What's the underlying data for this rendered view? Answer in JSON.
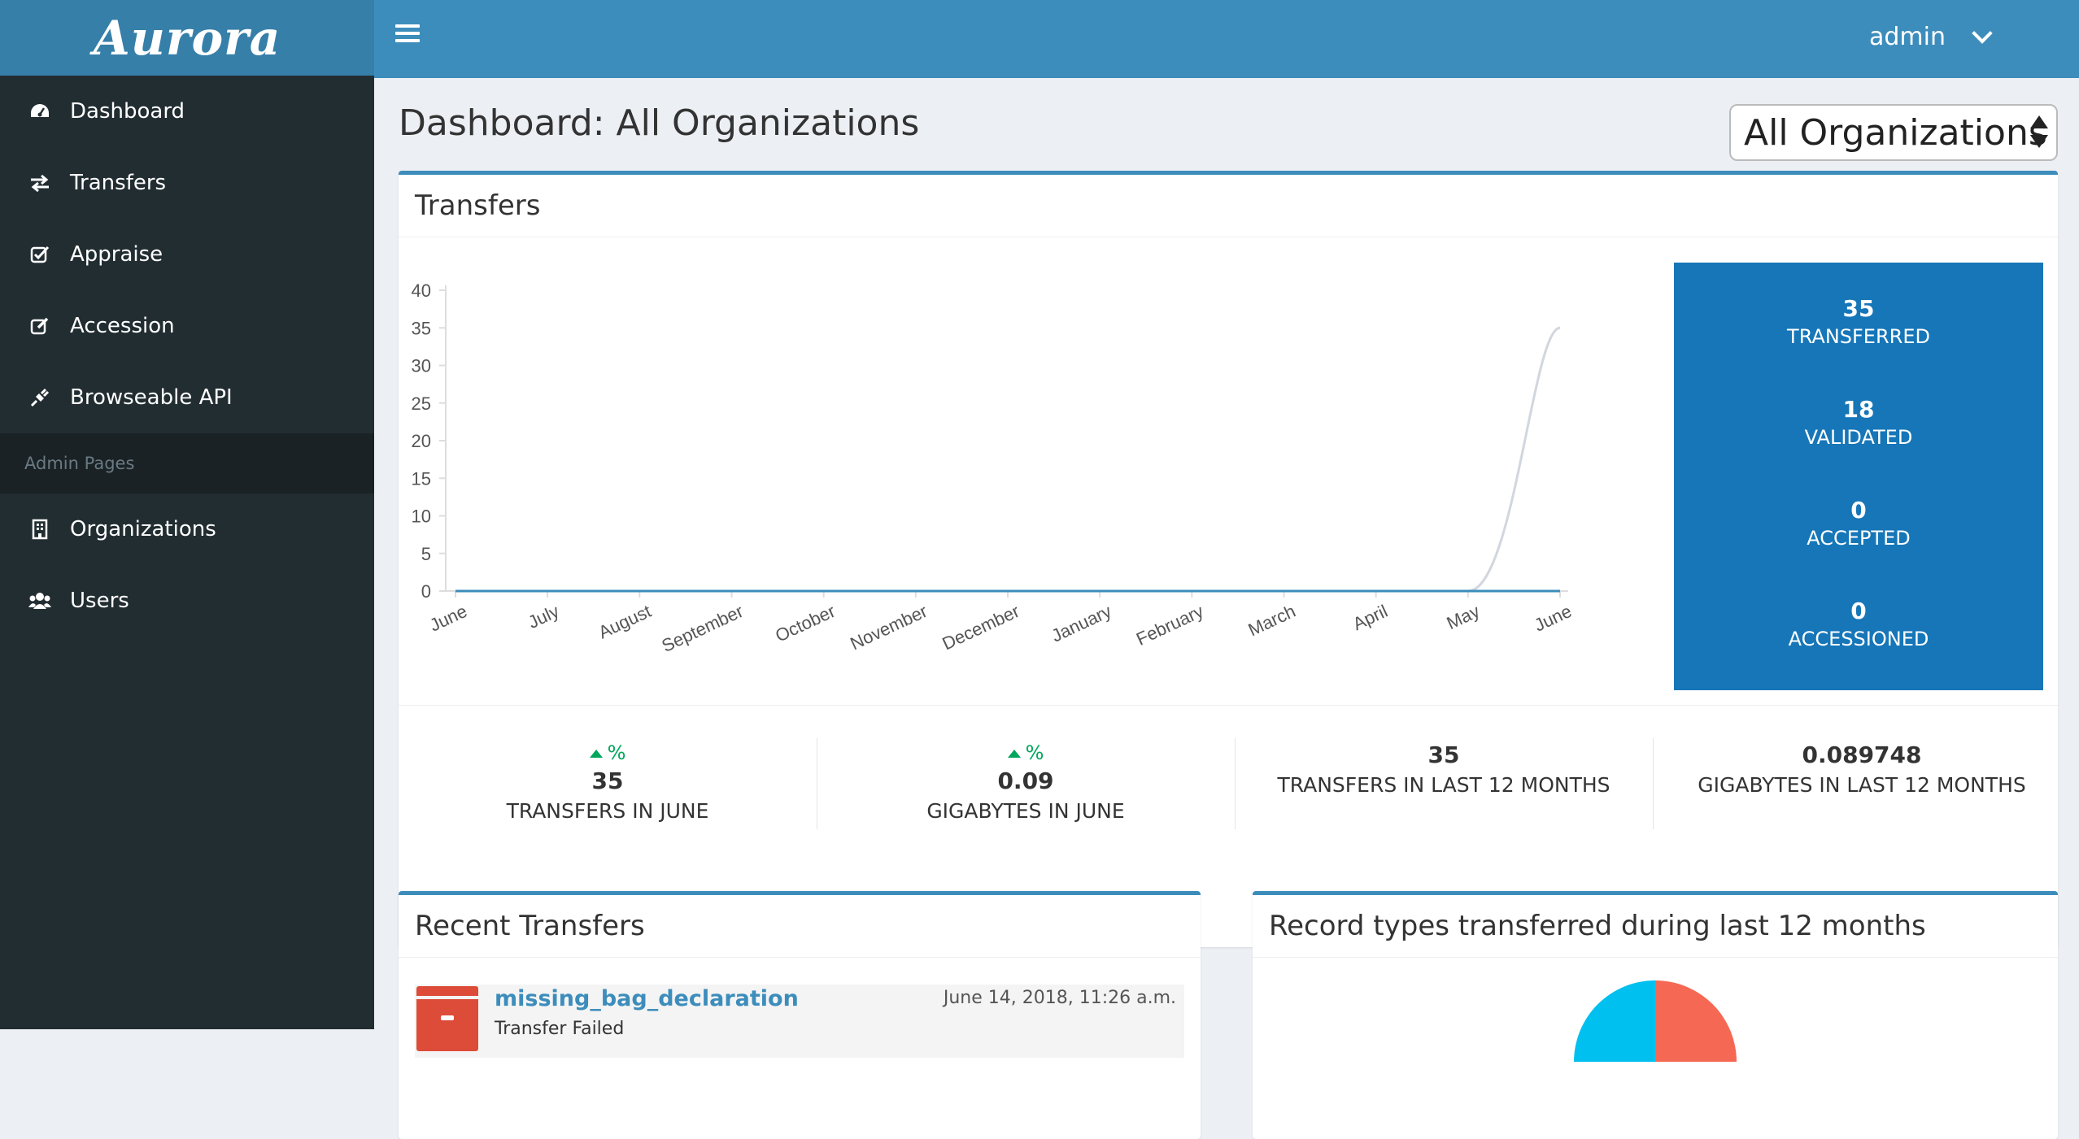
{
  "app": {
    "logo": "Aurora"
  },
  "header": {
    "user": "admin"
  },
  "sidebar": {
    "items": [
      {
        "label": "Dashboard",
        "icon": "dashboard-icon"
      },
      {
        "label": "Transfers",
        "icon": "exchange-icon"
      },
      {
        "label": "Appraise",
        "icon": "check-square-icon"
      },
      {
        "label": "Accession",
        "icon": "edit-icon"
      },
      {
        "label": "Browseable API",
        "icon": "plug-icon"
      }
    ],
    "admin_header": "Admin Pages",
    "admin_items": [
      {
        "label": "Organizations",
        "icon": "building-icon"
      },
      {
        "label": "Users",
        "icon": "users-icon"
      }
    ]
  },
  "main": {
    "title": "Dashboard: All Organizations",
    "org_select": "All Organizations",
    "transfers_box": {
      "title": "Transfers",
      "stats": [
        {
          "value": "35",
          "label": "TRANSFERRED"
        },
        {
          "value": "18",
          "label": "VALIDATED"
        },
        {
          "value": "0",
          "label": "ACCEPTED"
        },
        {
          "value": "0",
          "label": "ACCESSIONED"
        }
      ],
      "summary": [
        {
          "change": "%",
          "value": "35",
          "label": "TRANSFERS IN JUNE"
        },
        {
          "change": "%",
          "value": "0.09",
          "label": "GIGABYTES IN JUNE"
        },
        {
          "value": "35",
          "label": "TRANSFERS IN LAST 12 MONTHS"
        },
        {
          "value": "0.089748",
          "label": "GIGABYTES IN LAST 12 MONTHS"
        }
      ]
    },
    "recent_transfers": {
      "title": "Recent Transfers",
      "items": [
        {
          "name": "missing_bag_declaration",
          "status": "Transfer Failed",
          "date": "June 14, 2018, 11:26 a.m.",
          "status_color": "#dd4b39"
        }
      ]
    },
    "record_types": {
      "title": "Record types transferred during last 12 months"
    }
  },
  "chart_data": {
    "type": "line",
    "categories": [
      "June",
      "July",
      "August",
      "September",
      "October",
      "November",
      "December",
      "January",
      "February",
      "March",
      "April",
      "May",
      "June"
    ],
    "series": [
      {
        "values": [
          0,
          0,
          0,
          0,
          0,
          0,
          0,
          0,
          0,
          0,
          0,
          0,
          35
        ],
        "color": "#d2d6de"
      },
      {
        "values": [
          0,
          0,
          0,
          0,
          0,
          0,
          0,
          0,
          0,
          0,
          0,
          0,
          0
        ],
        "color": "#3c8dbc"
      }
    ],
    "ylim": [
      0,
      40
    ],
    "yticks": [
      0,
      5,
      10,
      15,
      20,
      25,
      30,
      35,
      40
    ]
  }
}
